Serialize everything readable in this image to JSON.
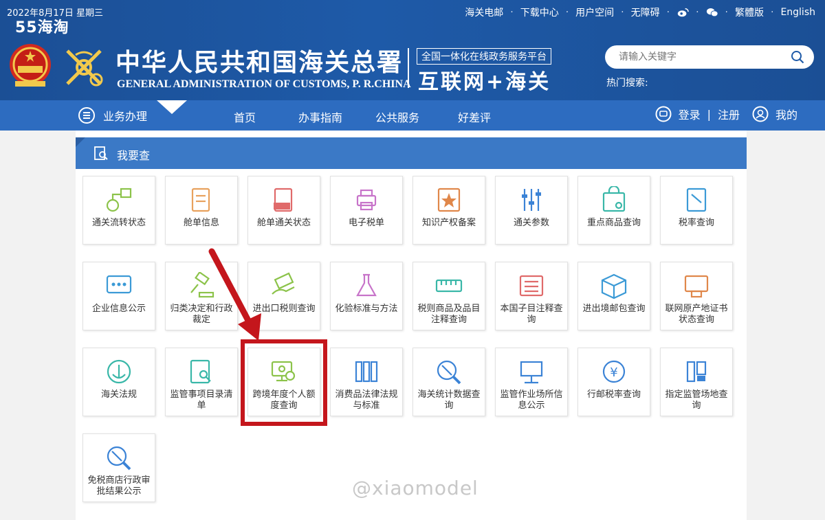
{
  "header": {
    "date": "2022年8月17日  星期三",
    "brand_watermark": "55海淘",
    "top_links": [
      "海关电邮",
      "下载中心",
      "用户空间",
      "无障碍"
    ],
    "lang_links": [
      "繁體版",
      "English"
    ],
    "title_cn": "中华人民共和国海关总署",
    "title_en": "GENERAL ADMINISTRATION OF CUSTOMS, P. R.CHINA",
    "platform_small": "全国一体化在线政务服务平台",
    "platform_big": "互联网+海关",
    "search_placeholder": "请输入关键字",
    "hot_search": "热门搜索:"
  },
  "nav": {
    "menu_label": "业务办理",
    "items": [
      "首页",
      "办事指南",
      "公共服务",
      "好差评"
    ],
    "login": "登录",
    "divider": "|",
    "register": "注册",
    "mine": "我的"
  },
  "section": {
    "title": "我要查"
  },
  "tiles": [
    {
      "label": "通关流转状态",
      "icon": "flow-icon",
      "color": "#8cc34a"
    },
    {
      "label": "舱单信息",
      "icon": "manifest-icon",
      "color": "#e8a15d"
    },
    {
      "label": "舱单通关状态",
      "icon": "manifest-new-icon",
      "color": "#e06a6a"
    },
    {
      "label": "电子税单",
      "icon": "printer-icon",
      "color": "#c773c9"
    },
    {
      "label": "知识产权备案",
      "icon": "ip-star-icon",
      "color": "#e0874a"
    },
    {
      "label": "通关参数",
      "icon": "sliders-icon",
      "color": "#3b83d6"
    },
    {
      "label": "重点商品查询",
      "icon": "bag-search-icon",
      "color": "#39b7a8"
    },
    {
      "label": "税率查询",
      "icon": "book-icon",
      "color": "#3b9ad6"
    },
    {
      "label": "企业信息公示",
      "icon": "chat-icon",
      "color": "#3b9ad6"
    },
    {
      "label": "归类决定和行政裁定",
      "icon": "gavel-icon",
      "color": "#8cc34a"
    },
    {
      "label": "进出口税则查询",
      "icon": "money-hand-icon",
      "color": "#8cc34a"
    },
    {
      "label": "化验标准与方法",
      "icon": "flask-icon",
      "color": "#c773c9"
    },
    {
      "label": "税则商品及品目注释查询",
      "icon": "ruler-icon",
      "color": "#39b7a8"
    },
    {
      "label": "本国子目注释查询",
      "icon": "list-icon",
      "color": "#e06a6a"
    },
    {
      "label": "进出境邮包查询",
      "icon": "box-icon",
      "color": "#3b9ad6"
    },
    {
      "label": "联网原产地证书状态查询",
      "icon": "certificate-icon",
      "color": "#e0874a"
    },
    {
      "label": "海关法规",
      "icon": "anchor-icon",
      "color": "#39b7a8"
    },
    {
      "label": "监管事项目录清单",
      "icon": "doc-search-icon",
      "color": "#39b7a8"
    },
    {
      "label": "跨境年度个人额度查询",
      "icon": "monitor-search-icon",
      "color": "#8cc34a"
    },
    {
      "label": "消费品法律法规与标准",
      "icon": "binders-icon",
      "color": "#3b83d6"
    },
    {
      "label": "海关统计数据查询",
      "icon": "magnifier-tools-icon",
      "color": "#3b83d6"
    },
    {
      "label": "监管作业场所信息公示",
      "icon": "easel-icon",
      "color": "#3b83d6"
    },
    {
      "label": "行邮税率查询",
      "icon": "yuan-cycle-icon",
      "color": "#3b83d6"
    },
    {
      "label": "指定监管场地查询",
      "icon": "site-icon",
      "color": "#3b83d6"
    },
    {
      "label": "免税商店行政审批结果公示",
      "icon": "magnifier-tools-icon",
      "color": "#3b83d6"
    }
  ],
  "watermark": "@xiaomodel"
}
